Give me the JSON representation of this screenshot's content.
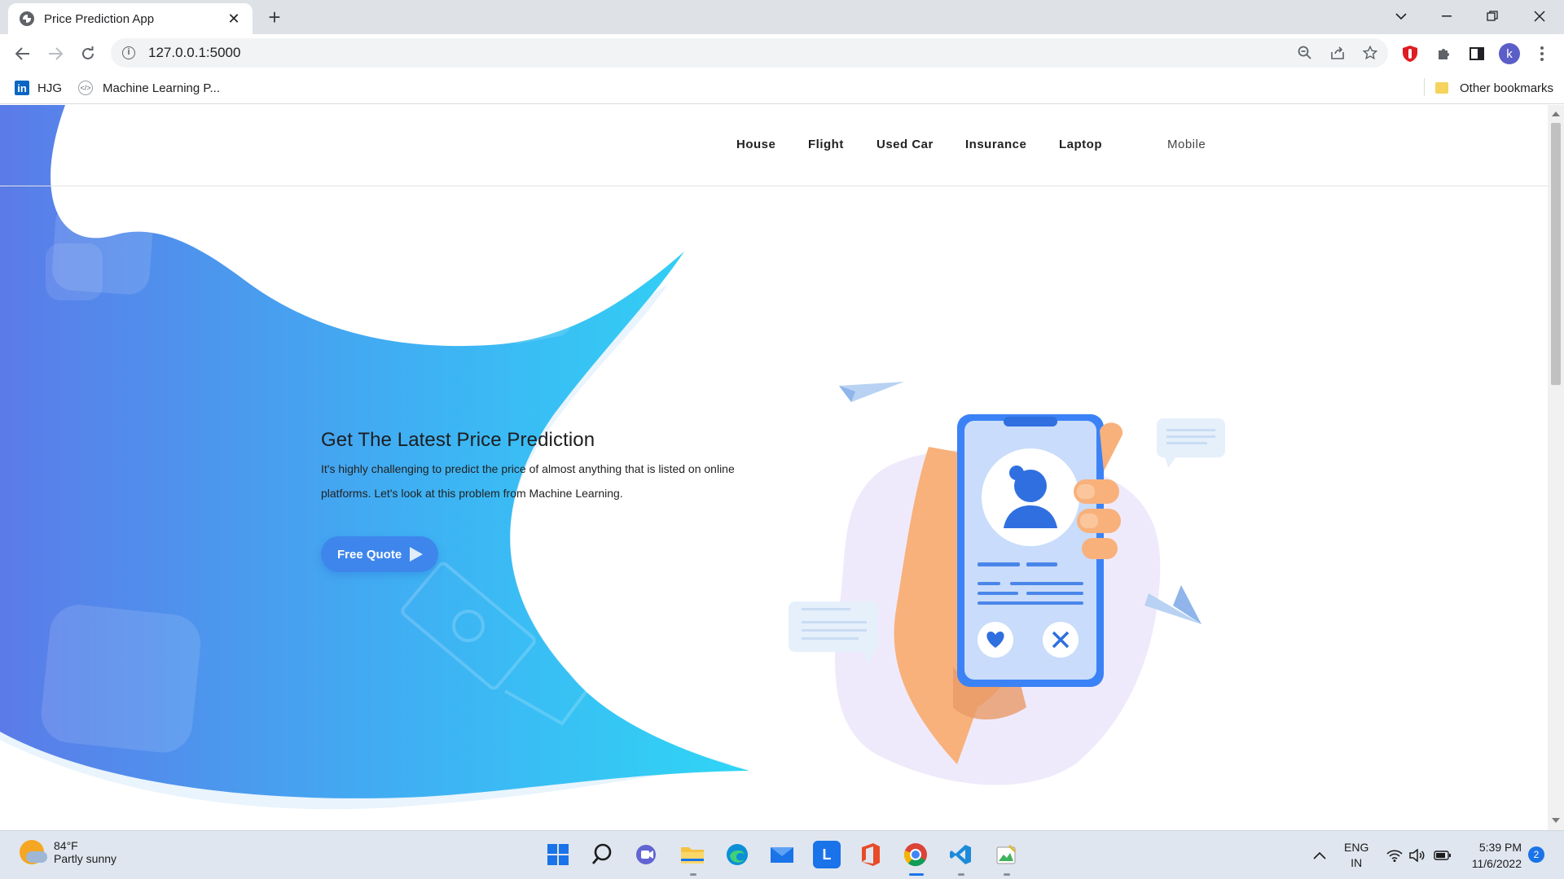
{
  "browser": {
    "tab_title": "Price Prediction App",
    "tab_close": "✕",
    "new_tab": "+",
    "url": "127.0.0.1:5000",
    "profile_initial": "k",
    "bookmarks": [
      {
        "label": "HJG",
        "icon": "linkedin-icon"
      },
      {
        "label": "Machine Learning P...",
        "icon": "code-icon"
      }
    ],
    "other_bookmarks": "Other bookmarks"
  },
  "site": {
    "nav": [
      "House",
      "Flight",
      "Used Car",
      "Insurance",
      "Laptop",
      "Mobile"
    ],
    "hero": {
      "title": "Get The Latest Price Prediction",
      "description": "It's highly challenging to predict the price of almost anything that is listed on online platforms. Let's look at this problem from Machine Learning.",
      "button": "Free Quote"
    }
  },
  "taskbar": {
    "weather_temp": "84°F",
    "weather_desc": "Partly sunny",
    "lang_line1": "ENG",
    "lang_line2": "IN",
    "time": "5:39 PM",
    "date": "11/6/2022",
    "notifications": "2"
  },
  "colors": {
    "hero_gradient_start": "#5b7be8",
    "hero_gradient_end": "#2fd6f5",
    "button": "#3e86ec",
    "phone_frame": "#3b82f6"
  }
}
